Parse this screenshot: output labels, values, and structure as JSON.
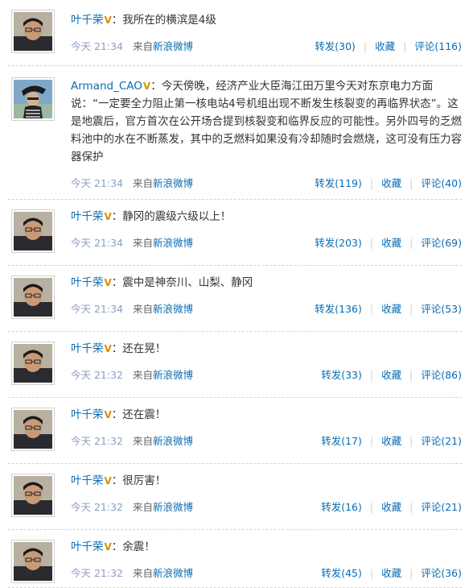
{
  "labels": {
    "from": "来自",
    "repost": "转发",
    "favorite": "收藏",
    "comment": "评论",
    "colon": "："
  },
  "colors": {
    "link": "#0a6cb3",
    "verified_badge": "#e08a00",
    "time": "#8aa0c0"
  },
  "posts": [
    {
      "author": "叶千荣",
      "verified": "V",
      "avatar": "man-glasses",
      "text": "我所在的横滨是4级",
      "time": "今天 21:34",
      "source": "新浪微博",
      "repost": "转发(30)",
      "favorite": "收藏",
      "comment": "评论(116)"
    },
    {
      "author": "Armand_CAO",
      "verified": "V",
      "avatar": "man-hat-seaside",
      "text": "今天傍晚，经济产业大臣海江田万里今天对东京电力方面说：“一定要全力阻止第一核电站4号机组出现不断发生核裂变的再临界状态”。这是地震后，官方首次在公开场合提到核裂变和临界反应的可能性。另外四号的乏燃料池中的水在不断蒸发，其中的乏燃料如果没有冷却随时会燃烧，这可没有压力容器保护",
      "time": "今天 21:34",
      "source": "新浪微博",
      "repost": "转发(119)",
      "favorite": "收藏",
      "comment": "评论(40)"
    },
    {
      "author": "叶千荣",
      "verified": "V",
      "avatar": "man-glasses",
      "text": "静冈的震级六级以上！",
      "time": "今天 21:34",
      "source": "新浪微博",
      "repost": "转发(203)",
      "favorite": "收藏",
      "comment": "评论(69)"
    },
    {
      "author": "叶千荣",
      "verified": "V",
      "avatar": "man-glasses",
      "text": "震中是神奈川、山梨、静冈",
      "time": "今天 21:34",
      "source": "新浪微博",
      "repost": "转发(136)",
      "favorite": "收藏",
      "comment": "评论(53)"
    },
    {
      "author": "叶千荣",
      "verified": "V",
      "avatar": "man-glasses",
      "text": "还在晃！",
      "time": "今天 21:32",
      "source": "新浪微博",
      "repost": "转发(33)",
      "favorite": "收藏",
      "comment": "评论(86)"
    },
    {
      "author": "叶千荣",
      "verified": "V",
      "avatar": "man-glasses",
      "text": "还在震！",
      "time": "今天 21:32",
      "source": "新浪微博",
      "repost": "转发(17)",
      "favorite": "收藏",
      "comment": "评论(21)"
    },
    {
      "author": "叶千荣",
      "verified": "V",
      "avatar": "man-glasses",
      "text": "很厉害！",
      "time": "今天 21:32",
      "source": "新浪微博",
      "repost": "转发(16)",
      "favorite": "收藏",
      "comment": "评论(21)"
    },
    {
      "author": "叶千荣",
      "verified": "V",
      "avatar": "man-glasses",
      "text": "余震！",
      "time": "今天 21:32",
      "source": "新浪微博",
      "repost": "转发(45)",
      "favorite": "收藏",
      "comment": "评论(36)"
    }
  ]
}
